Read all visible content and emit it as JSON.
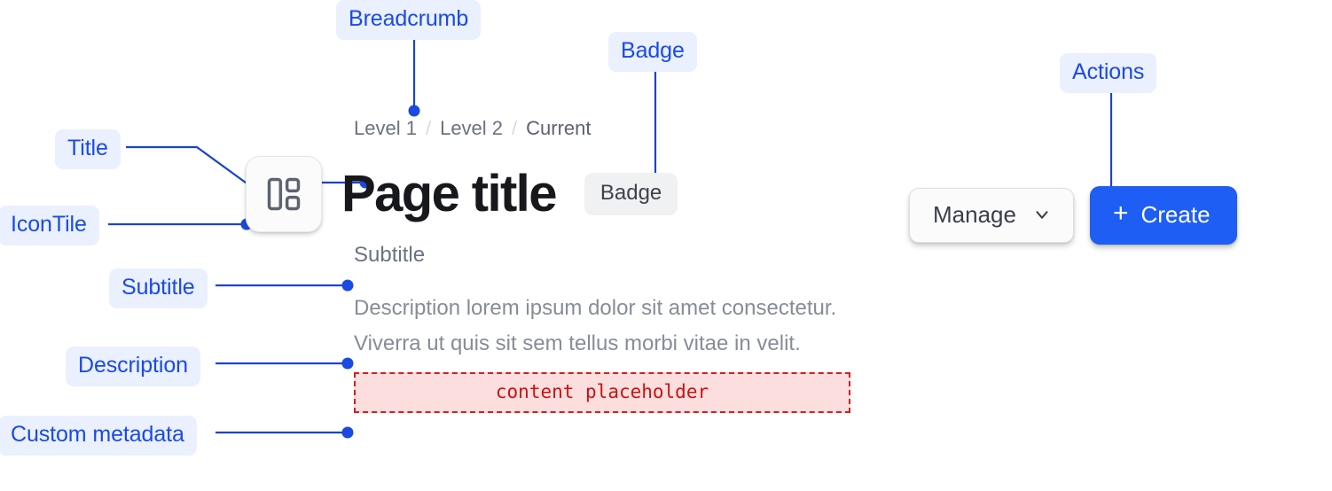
{
  "annotations": [
    {
      "key": "breadcrumb",
      "label": "Breadcrumb"
    },
    {
      "key": "badge",
      "label": "Badge"
    },
    {
      "key": "actions",
      "label": "Actions"
    },
    {
      "key": "title",
      "label": "Title"
    },
    {
      "key": "icontile",
      "label": "IconTile"
    },
    {
      "key": "subtitle",
      "label": "Subtitle"
    },
    {
      "key": "description",
      "label": "Description"
    },
    {
      "key": "metadata",
      "label": "Custom metadata"
    }
  ],
  "component": {
    "breadcrumb": {
      "items": [
        {
          "label": "Level 1",
          "current": false
        },
        {
          "label": "Level 2",
          "current": false
        },
        {
          "label": "Current",
          "current": true
        }
      ],
      "separator": "/"
    },
    "icon_tile": {
      "icon": "layout-dashboard-icon"
    },
    "title": "Page title",
    "badge": "Badge",
    "subtitle": "Subtitle",
    "description": "Description lorem ipsum dolor sit amet consectetur. Viverra ut quis sit sem tellus morbi vitae in velit.",
    "custom_metadata": "content placeholder"
  },
  "actions": {
    "manage": {
      "label": "Manage",
      "icon": "chevron-down-icon"
    },
    "create": {
      "label": "Create",
      "icon": "plus-icon"
    }
  },
  "colors": {
    "annotation_text": "#1a4ae8",
    "annotation_bg": "#eaf0fe",
    "connector": "#1a43d0",
    "primary_button": "#1f5ef5",
    "title_text": "#17181c",
    "muted_text": "#868d97",
    "badge_bg": "#f0f1f3",
    "placeholder_border": "#d81c1c",
    "placeholder_bg": "#fcdede"
  }
}
